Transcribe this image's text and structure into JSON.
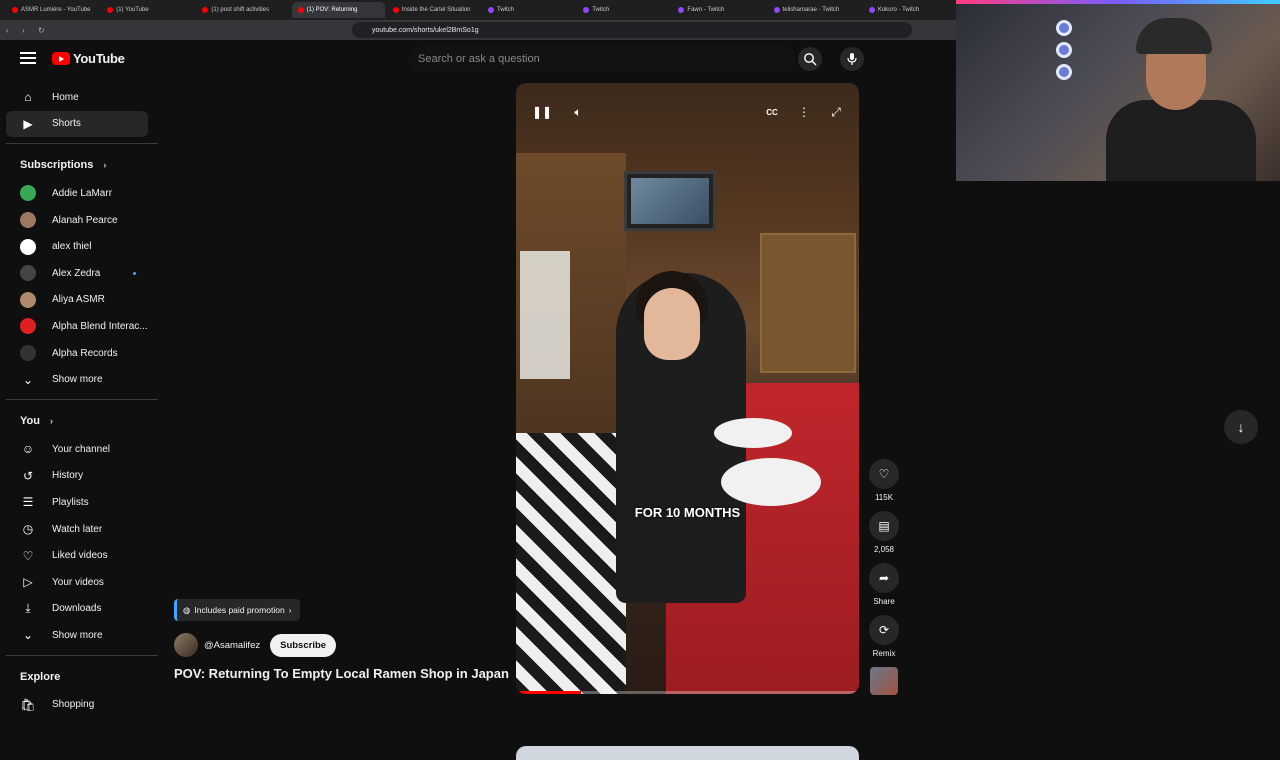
{
  "browser": {
    "tabs": [
      {
        "label": "ASMR Lumière - YouTube",
        "color": "#ff0000"
      },
      {
        "label": "(1) YouTube",
        "color": "#ff0000"
      },
      {
        "label": "(1) post shift activities",
        "color": "#ff0000"
      },
      {
        "label": "(1) POV: Returning",
        "color": "#ff0000",
        "active": true
      },
      {
        "label": "Inside the Cartel Situation",
        "color": "#ff0000"
      },
      {
        "label": "Twitch",
        "color": "#9146ff"
      },
      {
        "label": "Twitch",
        "color": "#9146ff"
      },
      {
        "label": "Fawn - Twitch",
        "color": "#9146ff"
      },
      {
        "label": "telishamarae - Twitch",
        "color": "#9146ff"
      },
      {
        "label": "Kokoro - Twitch",
        "color": "#9146ff"
      }
    ],
    "url": "youtube.com/shorts/ukel2BmSo1g"
  },
  "header": {
    "logo_text": "YouTube",
    "search_placeholder": "Search or ask a question"
  },
  "sidebar": {
    "main": [
      {
        "label": "Home",
        "icon": "home-icon"
      },
      {
        "label": "Shorts",
        "icon": "shorts-icon",
        "active": true
      }
    ],
    "subscriptions_title": "Subscriptions",
    "subscriptions": [
      {
        "label": "Addie LaMarr",
        "color": "#3aa757"
      },
      {
        "label": "Alanah Pearce",
        "color": "#a07860"
      },
      {
        "label": "alex thiel",
        "color": "#ffffff"
      },
      {
        "label": "Alex Zedra",
        "color": "#444444",
        "new": true
      },
      {
        "label": "Aliya ASMR",
        "color": "#b08a6a"
      },
      {
        "label": "Alpha Blend Interac...",
        "color": "#e02020"
      },
      {
        "label": "Alpha Records",
        "color": "#333333"
      }
    ],
    "subs_show_more": "Show more",
    "you_title": "You",
    "you": [
      {
        "label": "Your channel",
        "icon": "channel-icon"
      },
      {
        "label": "History",
        "icon": "history-icon"
      },
      {
        "label": "Playlists",
        "icon": "playlists-icon"
      },
      {
        "label": "Watch later",
        "icon": "watch-later-icon"
      },
      {
        "label": "Liked videos",
        "icon": "like-icon"
      },
      {
        "label": "Your videos",
        "icon": "your-videos-icon"
      },
      {
        "label": "Downloads",
        "icon": "download-icon"
      }
    ],
    "you_show_more": "Show more",
    "explore_title": "Explore",
    "explore": [
      {
        "label": "Shopping",
        "icon": "shopping-icon"
      }
    ]
  },
  "short": {
    "caption": "FOR 10 MONTHS",
    "progress": 0.19,
    "promo": "Includes paid promotion",
    "channel": "@Asamalifez",
    "subscribe_label": "Subscribe",
    "title": "POV: Returning To Empty Local Ramen Shop in Japan",
    "actions": {
      "likes": "115K",
      "comments": "2,058",
      "share": "Share",
      "remix": "Remix"
    }
  },
  "colors": {
    "accent": "#ff0000",
    "link": "#3ea6ff",
    "background": "#0f0f0f"
  }
}
